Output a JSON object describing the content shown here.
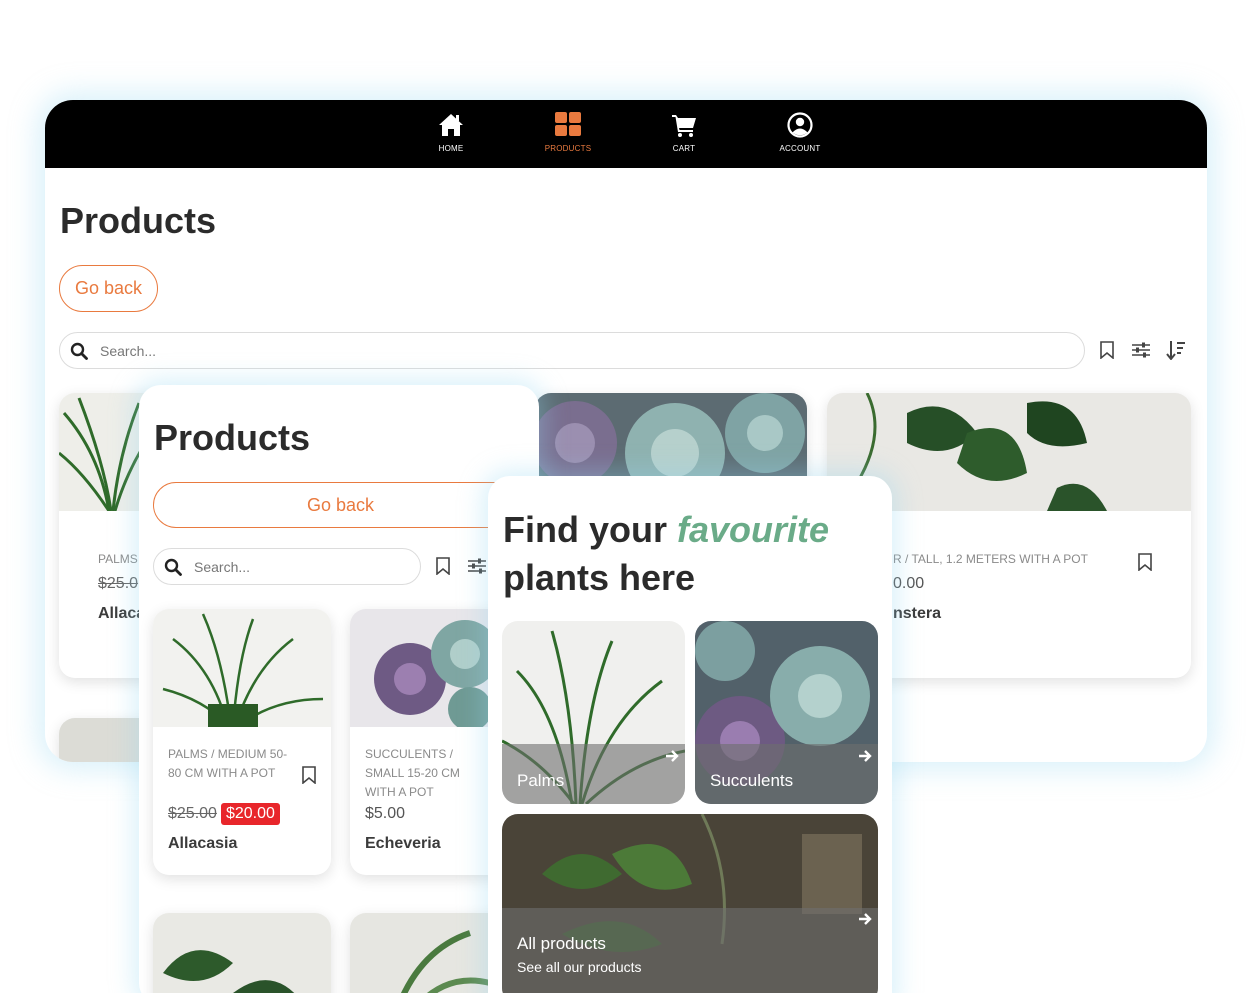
{
  "colors": {
    "accent": "#e97a3f",
    "sale": "#e8262b",
    "highlight": "#6aab88",
    "nav_bg": "#000000"
  },
  "nav": {
    "items": [
      {
        "label": "HOME",
        "icon": "home-icon"
      },
      {
        "label": "PRODUCTS",
        "icon": "grid-icon",
        "active": true
      },
      {
        "label": "CART",
        "icon": "cart-icon"
      },
      {
        "label": "ACCOUNT",
        "icon": "account-icon"
      }
    ]
  },
  "desktop": {
    "title": "Products",
    "go_back": "Go back",
    "search_placeholder": "Search...",
    "cards": [
      {
        "category": "PALMS",
        "price_old": "$25.0",
        "name": "Allaca"
      },
      {
        "category": "R / TALL, 1.2 METERS WITH A POT",
        "price": "0.00",
        "name": "nstera"
      }
    ]
  },
  "tablet": {
    "title": "Products",
    "go_back": "Go back",
    "search_placeholder": "Search...",
    "cards": [
      {
        "category": "PALMS / MEDIUM 50-80 CM WITH A POT",
        "price_old": "$25.00",
        "price_new": "$20.00",
        "name": "Allacasia"
      },
      {
        "category": "SUCCULENTS / SMALL 15-20 CM WITH A POT",
        "price": "$5.00",
        "name": "Echeveria"
      }
    ]
  },
  "phone": {
    "hero_line1": "Find your ",
    "hero_highlight": "favourite",
    "hero_line2": "plants here",
    "tiles": [
      {
        "label": "Palms"
      },
      {
        "label": "Succulents"
      },
      {
        "label": "All products",
        "sub": "See all our products"
      }
    ]
  }
}
